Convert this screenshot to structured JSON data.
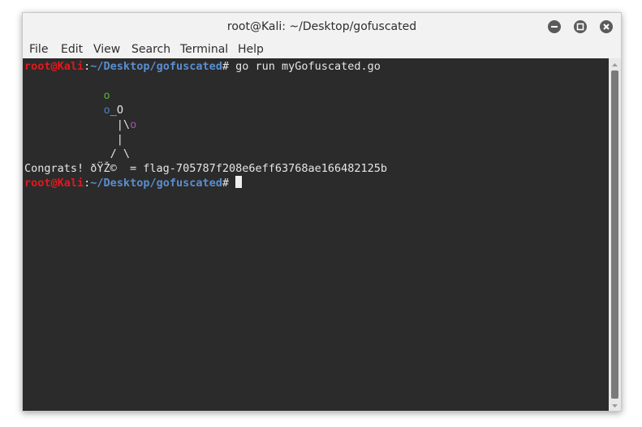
{
  "window": {
    "title": "root@Kali: ~/Desktop/gofuscated"
  },
  "menubar": {
    "items": [
      "File",
      "Edit",
      "View",
      "Search",
      "Terminal",
      "Help"
    ]
  },
  "terminal": {
    "prompt_user": "root@Kali",
    "prompt_sep": ":",
    "prompt_path": "~/Desktop/gofuscated",
    "prompt_hash": "#",
    "command": " go run myGofuscated.go",
    "art": {
      "line1_o": "o",
      "line2_o": "o",
      "line2_rest": "_O",
      "line3_pipe": "|\\",
      "line3_o": "o",
      "line4": "|",
      "line5": "/ \\"
    },
    "output": "Congrats! ðŸŽ©  = flag-705787f208e6eff63768ae166482125b"
  },
  "colors": {
    "terminal_bg": "#2b2b2b",
    "prompt_user": "#e0191e",
    "prompt_path": "#5a8ecf"
  },
  "icons": {
    "minimize": "minimize-icon",
    "maximize": "maximize-icon",
    "close": "close-icon"
  }
}
